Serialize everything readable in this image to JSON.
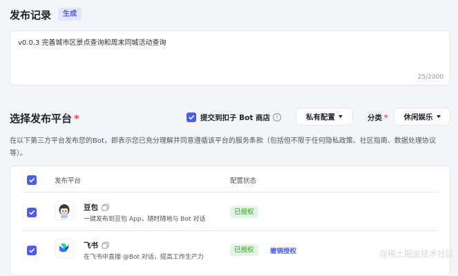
{
  "release_log": {
    "title": "发布记录",
    "badge": "生成",
    "text": "v0.0.3 完善城市区景点查询和周末同城活动查询",
    "counter": "25/2000"
  },
  "platform_section": {
    "title": "选择发布平台",
    "required_mark": "*",
    "submit_store_label": "提交到扣子 Bot 商店",
    "info_icon": "ⓘ",
    "private_config_label": "私有配置",
    "category_label": "分类",
    "category_value": "休闲娱乐",
    "terms": "在以下第三方平台发布您的Bot，即表示您已充分理解并同意遵循该平台的服务条款（包括但不限于任何隐私政策、社区指南、数据处理协议等）。"
  },
  "table": {
    "headers": {
      "platform": "发布平台",
      "status": "配置状态"
    },
    "rows": [
      {
        "name": "豆包",
        "desc": "一键发布到豆包 App，随时随地与 Bot 对话",
        "status": "已授权",
        "action": ""
      },
      {
        "name": "飞书",
        "desc": "在飞书中直接 @Bot 对话，提高工作生产力",
        "status": "已授权",
        "action": "撤销授权"
      }
    ]
  },
  "watermark": "@稀土掘金技术社区",
  "colors": {
    "accent": "#4e5ce6",
    "success": "#2ea121",
    "required": "#f54a45",
    "background": "#f4f5f9"
  }
}
